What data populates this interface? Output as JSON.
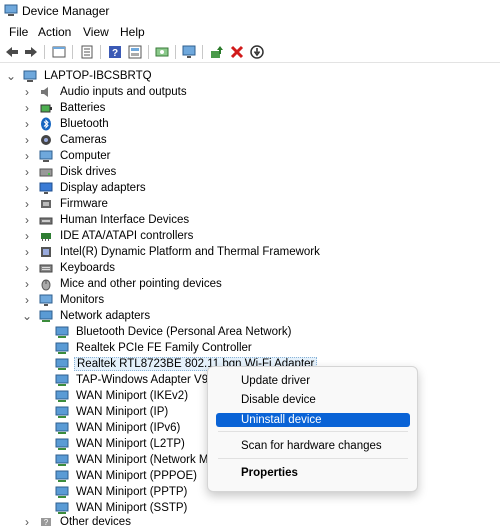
{
  "window": {
    "title": "Device Manager"
  },
  "menu": [
    "File",
    "Action",
    "View",
    "Help"
  ],
  "toolbar": {
    "buttons": [
      "back-icon",
      "forward-icon",
      "properties-icon",
      "show-hidden-icon",
      "help-icon",
      "view-icon",
      "scan-hardware-icon",
      "monitor-icon",
      "update-driver-icon",
      "uninstall-icon",
      "disable-icon"
    ]
  },
  "tree": {
    "root": "LAPTOP-IBCSBRTQ",
    "categories": [
      {
        "label": "Audio inputs and outputs",
        "icon": "speaker-icon"
      },
      {
        "label": "Batteries",
        "icon": "battery-icon"
      },
      {
        "label": "Bluetooth",
        "icon": "bluetooth-icon"
      },
      {
        "label": "Cameras",
        "icon": "camera-icon"
      },
      {
        "label": "Computer",
        "icon": "computer-icon"
      },
      {
        "label": "Disk drives",
        "icon": "disk-drive-icon"
      },
      {
        "label": "Display adapters",
        "icon": "display-adapter-icon"
      },
      {
        "label": "Firmware",
        "icon": "firmware-icon"
      },
      {
        "label": "Human Interface Devices",
        "icon": "hid-icon"
      },
      {
        "label": "IDE ATA/ATAPI controllers",
        "icon": "ide-controller-icon"
      },
      {
        "label": "Intel(R) Dynamic Platform and Thermal Framework",
        "icon": "intel-thermal-icon"
      },
      {
        "label": "Keyboards",
        "icon": "keyboard-icon"
      },
      {
        "label": "Mice and other pointing devices",
        "icon": "mouse-icon"
      },
      {
        "label": "Monitors",
        "icon": "monitor-icon"
      },
      {
        "label": "Network adapters",
        "icon": "network-adapter-icon"
      }
    ],
    "network_adapters": [
      "Bluetooth Device (Personal Area Network)",
      "Realtek PCIe FE Family Controller",
      "Realtek RTL8723BE 802.11 bgn Wi-Fi Adapter",
      "TAP-Windows Adapter V9",
      "WAN Miniport (IKEv2)",
      "WAN Miniport (IP)",
      "WAN Miniport (IPv6)",
      "WAN Miniport (L2TP)",
      "WAN Miniport (Network Monitor)",
      "WAN Miniport (PPPOE)",
      "WAN Miniport (PPTP)",
      "WAN Miniport (SSTP)"
    ],
    "last_category": "Other devices"
  },
  "context_menu": {
    "update": "Update driver",
    "disable": "Disable device",
    "uninstall": "Uninstall device",
    "scan": "Scan for hardware changes",
    "properties": "Properties"
  },
  "colors": {
    "highlight": "#0a63d6",
    "selection_bg": "#e5f1fb"
  }
}
